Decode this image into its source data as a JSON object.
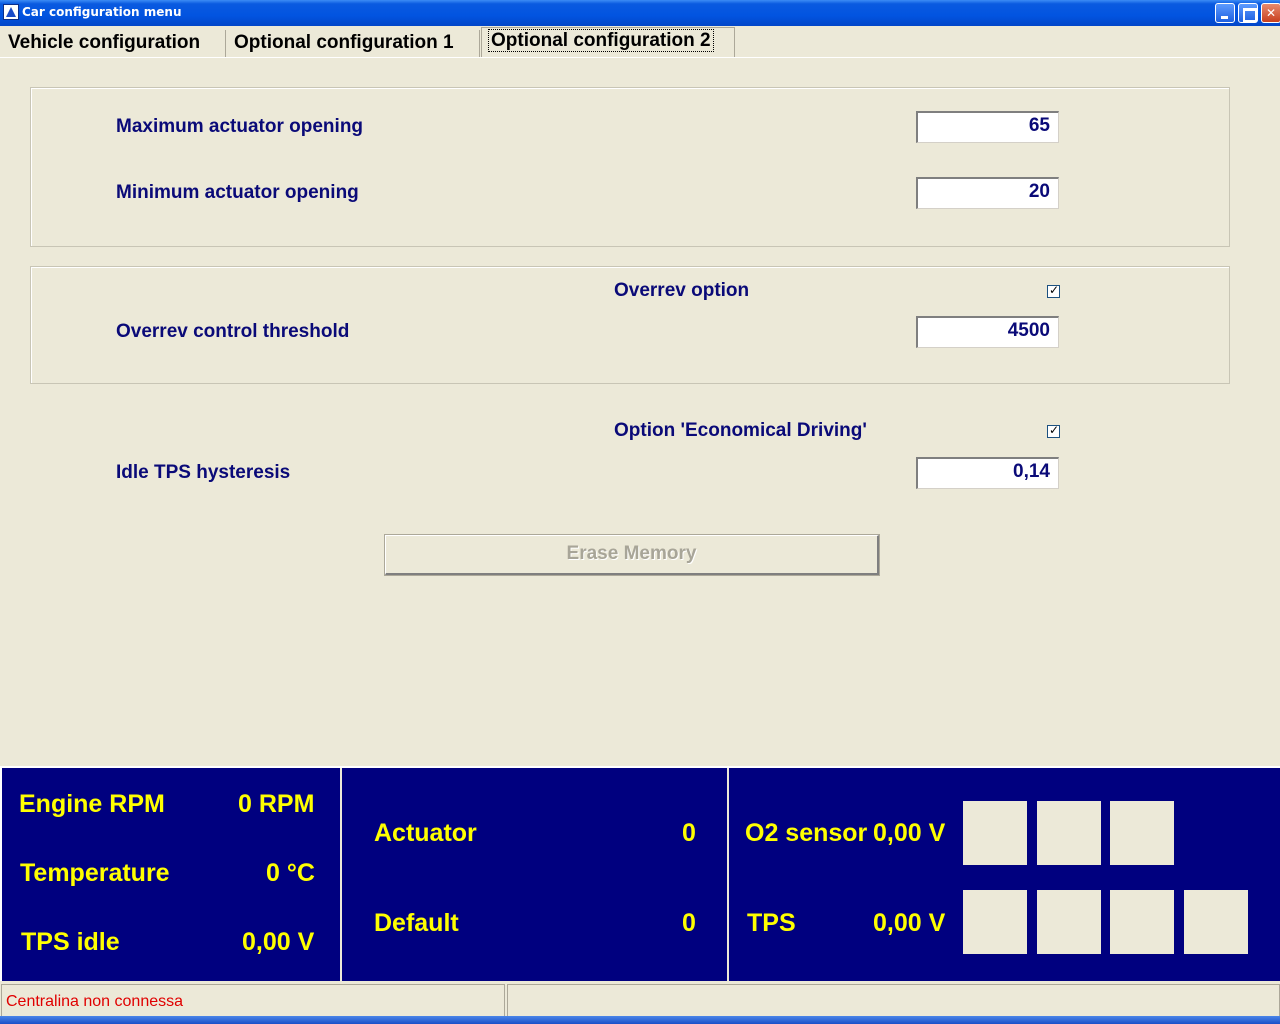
{
  "window": {
    "title": "Car configuration menu"
  },
  "tabs": [
    {
      "label": "Vehicle configuration"
    },
    {
      "label": "Optional configuration 1"
    },
    {
      "label": "Optional configuration 2",
      "active": true
    }
  ],
  "actuator_group": {
    "max_label": "Maximum actuator opening",
    "max_value": "65",
    "min_label": "Minimum actuator opening",
    "min_value": "20"
  },
  "overrev_group": {
    "option_label": "Overrev option",
    "option_checked": true,
    "threshold_label": "Overrev control threshold",
    "threshold_value": "4500"
  },
  "economy": {
    "option_label": "Option 'Economical Driving'",
    "option_checked": true,
    "hysteresis_label": "Idle TPS hysteresis",
    "hysteresis_value": "0,14"
  },
  "erase_button": {
    "label": "Erase Memory",
    "enabled": false
  },
  "dashboard": {
    "engine_rpm_label": "Engine RPM",
    "engine_rpm_value": "0 RPM",
    "temperature_label": "Temperature",
    "temperature_value": "0 °C",
    "tps_idle_label": "TPS idle",
    "tps_idle_value": "0,00 V",
    "actuator_label": "Actuator",
    "actuator_value": "0",
    "default_label": "Default",
    "default_value": "0",
    "o2_sensor_label": "O2 sensor",
    "o2_sensor_value": "0,00 V",
    "tps_label": "TPS",
    "tps_value": "0,00 V"
  },
  "status": {
    "message": "Centralina non connessa",
    "color": "#e00000"
  },
  "colors": {
    "dashboard_bg": "#00007f",
    "dashboard_text": "#ffff00",
    "label_text": "#0a0a78"
  }
}
